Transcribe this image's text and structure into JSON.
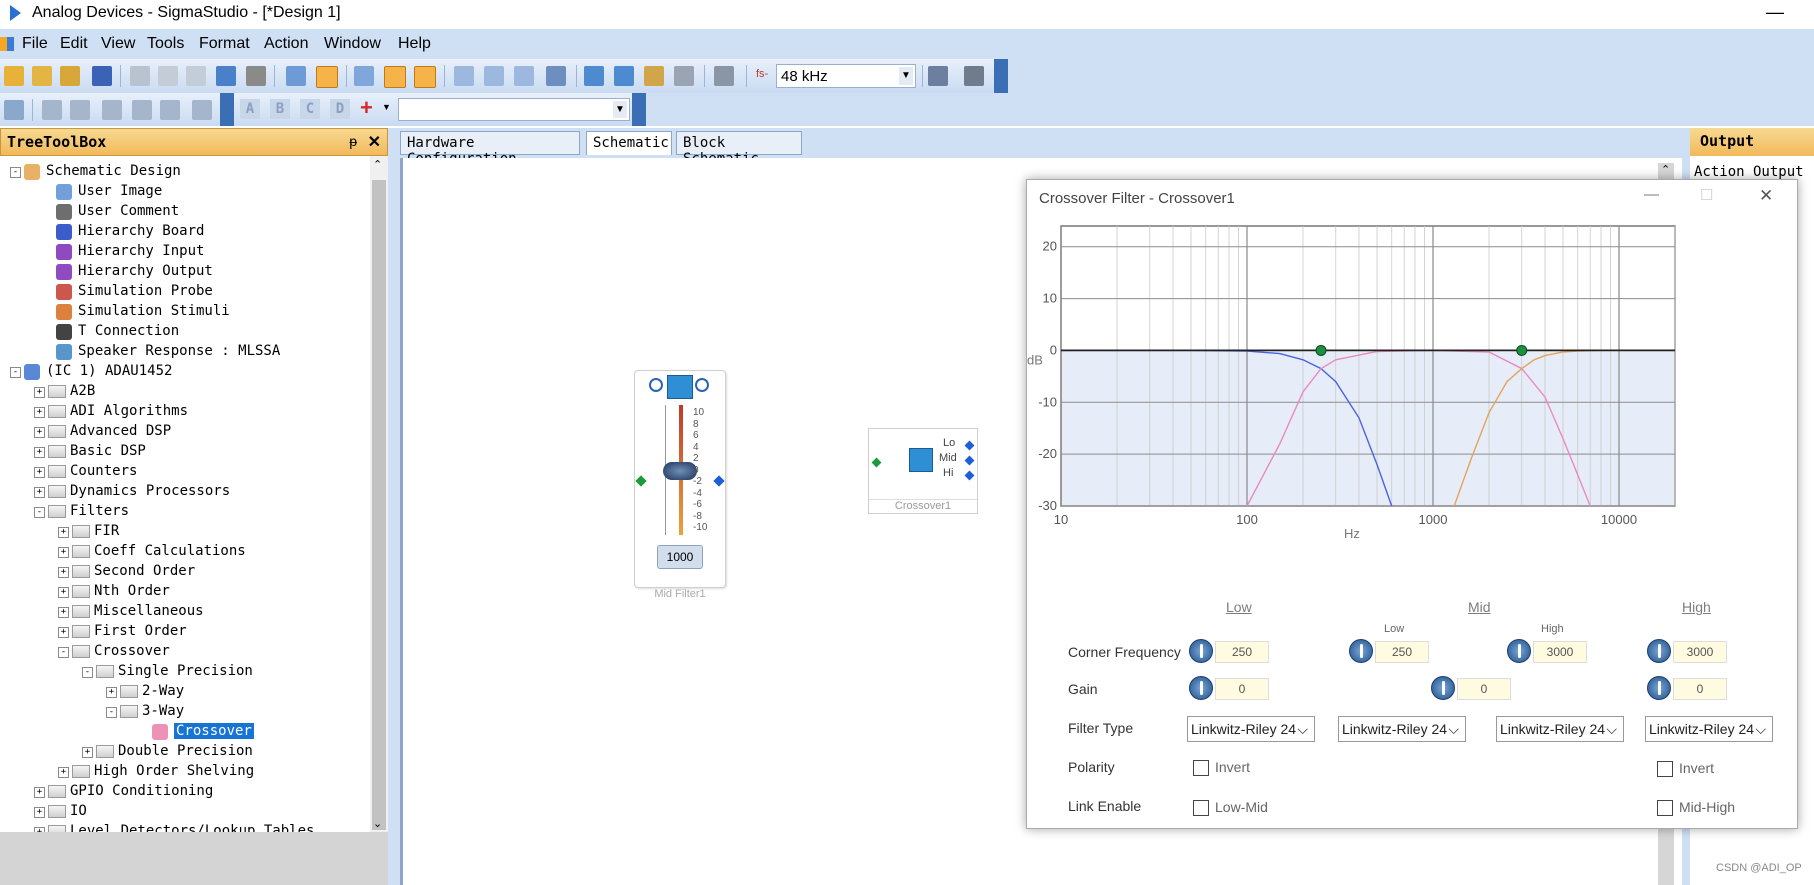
{
  "window": {
    "title": "Analog Devices - SigmaStudio - [*Design 1]",
    "minimize": "—"
  },
  "menu": [
    "File",
    "Edit",
    "View",
    "Tools",
    "Format",
    "Action",
    "Window",
    "Help"
  ],
  "toolbar": {
    "sample_rate": "48 kHz",
    "fs_label": "fs-",
    "style_buttons": [
      "A",
      "B",
      "C",
      "D"
    ],
    "plus": "+"
  },
  "tree": {
    "header": "TreeToolBox",
    "pin": "ᵽ",
    "close": "✕",
    "nodes": [
      {
        "label": "Schematic Design",
        "level": 0,
        "exp": "-",
        "kind": "design"
      },
      {
        "label": "User Image",
        "level": 1,
        "kind": "image"
      },
      {
        "label": "User Comment",
        "level": 1,
        "kind": "comment"
      },
      {
        "label": "Hierarchy Board",
        "level": 1,
        "kind": "board"
      },
      {
        "label": "Hierarchy Input",
        "level": 1,
        "kind": "input"
      },
      {
        "label": "Hierarchy Output",
        "level": 1,
        "kind": "output"
      },
      {
        "label": "Simulation Probe",
        "level": 1,
        "kind": "probe"
      },
      {
        "label": "Simulation Stimuli",
        "level": 1,
        "kind": "stimuli"
      },
      {
        "label": "T Connection",
        "level": 1,
        "kind": "tconn"
      },
      {
        "label": "Speaker Response : MLSSA",
        "level": 1,
        "kind": "speaker"
      },
      {
        "label": "(IC 1) ADAU1452",
        "level": 0,
        "exp": "-",
        "kind": "ic"
      },
      {
        "label": "A2B",
        "level": 1,
        "exp": "+",
        "kind": "folder"
      },
      {
        "label": "ADI Algorithms",
        "level": 1,
        "exp": "+",
        "kind": "folder"
      },
      {
        "label": "Advanced DSP",
        "level": 1,
        "exp": "+",
        "kind": "folder"
      },
      {
        "label": "Basic DSP",
        "level": 1,
        "exp": "+",
        "kind": "folder"
      },
      {
        "label": "Counters",
        "level": 1,
        "exp": "+",
        "kind": "folder"
      },
      {
        "label": "Dynamics Processors",
        "level": 1,
        "exp": "+",
        "kind": "folder"
      },
      {
        "label": "Filters",
        "level": 1,
        "exp": "-",
        "kind": "folder"
      },
      {
        "label": "FIR",
        "level": 2,
        "exp": "+",
        "kind": "folder"
      },
      {
        "label": "Coeff Calculations",
        "level": 2,
        "exp": "+",
        "kind": "folder"
      },
      {
        "label": "Second Order",
        "level": 2,
        "exp": "+",
        "kind": "folder"
      },
      {
        "label": "Nth Order",
        "level": 2,
        "exp": "+",
        "kind": "folder"
      },
      {
        "label": "Miscellaneous",
        "level": 2,
        "exp": "+",
        "kind": "folder"
      },
      {
        "label": "First Order",
        "level": 2,
        "exp": "+",
        "kind": "folder"
      },
      {
        "label": "Crossover",
        "level": 2,
        "exp": "-",
        "kind": "folder"
      },
      {
        "label": "Single Precision",
        "level": 3,
        "exp": "-",
        "kind": "folder"
      },
      {
        "label": "2-Way",
        "level": 4,
        "exp": "+",
        "kind": "folder"
      },
      {
        "label": "3-Way",
        "level": 4,
        "exp": "-",
        "kind": "folder"
      },
      {
        "label": "Crossover",
        "level": 5,
        "kind": "cell",
        "selected": true
      },
      {
        "label": "Double Precision",
        "level": 3,
        "exp": "+",
        "kind": "folder"
      },
      {
        "label": "High Order Shelving",
        "level": 2,
        "exp": "+",
        "kind": "folder"
      },
      {
        "label": "GPIO Conditioning",
        "level": 1,
        "exp": "+",
        "kind": "folder"
      },
      {
        "label": "IO",
        "level": 1,
        "exp": "+",
        "kind": "folder"
      },
      {
        "label": "Level Detectors/Lookup Tables",
        "level": 1,
        "exp": "+",
        "kind": "folder"
      }
    ]
  },
  "tabs": [
    "Hardware Configuration",
    "Schematic",
    "Block Schematic"
  ],
  "active_tab": "Schematic",
  "output_panel": {
    "header": "Output",
    "item": "Action Output"
  },
  "mid_filter": {
    "name": "Mid Filter1",
    "scale": [
      "10",
      "8",
      "6",
      "4",
      "2",
      "0",
      "-2",
      "-4",
      "-6",
      "-8",
      "-10"
    ],
    "value": "1000",
    "level": 0
  },
  "crossover_block": {
    "name": "Crossover1",
    "outputs": [
      "Lo",
      "Mid",
      "Hi"
    ]
  },
  "dialog": {
    "title": "Crossover Filter - Crossover1",
    "controls": {
      "minimize": "—",
      "maximize": "☐",
      "close": "✕"
    },
    "bands": [
      "Low",
      "Mid",
      "High"
    ],
    "sub_labels": {
      "low": "Low",
      "high": "High"
    },
    "rows": {
      "corner_frequency": "Corner Frequency",
      "gain": "Gain",
      "filter_type": "Filter Type",
      "polarity": "Polarity",
      "link_enable": "Link Enable"
    },
    "corner_values": [
      "250",
      "250",
      "3000",
      "3000"
    ],
    "gain_values": [
      "0",
      "0",
      "0"
    ],
    "filter_types": [
      "Linkwitz-Riley 24",
      "Linkwitz-Riley 24",
      "Linkwitz-Riley 24",
      "Linkwitz-Riley 24"
    ],
    "invert_label": "Invert",
    "low_mid_label": "Low-Mid",
    "mid_high_label": "Mid-High",
    "chevron": "⌵"
  },
  "chart_data": {
    "type": "line",
    "xlabel": "Hz",
    "ylabel": "dB",
    "xscale": "log",
    "xlim": [
      10,
      20000
    ],
    "ylim": [
      -30,
      24
    ],
    "xticks": [
      "10",
      "100",
      "1000",
      "10000"
    ],
    "yticks": [
      "20",
      "10",
      "0",
      "-10",
      "-20",
      "-30"
    ],
    "grid": true,
    "series": [
      {
        "color": "#4a63e0",
        "x": [
          10,
          50,
          100,
          150,
          200,
          250,
          300,
          400,
          500,
          600
        ],
        "y": [
          0,
          0,
          -0.1,
          -0.6,
          -1.8,
          -3.5,
          -6,
          -13,
          -22,
          -31
        ]
      },
      {
        "color": "#e98ac0",
        "x": [
          100,
          150,
          200,
          250,
          300,
          500,
          1000,
          2000,
          3000,
          4000,
          5000,
          6000,
          7000
        ],
        "y": [
          -31,
          -18,
          -8,
          -3.5,
          -1.8,
          -0.2,
          0,
          -0.3,
          -3.5,
          -9,
          -17,
          -24,
          -31
        ]
      },
      {
        "color": "#e6a35a",
        "x": [
          1300,
          1600,
          2000,
          2500,
          3000,
          3500,
          4000,
          5000,
          6000,
          8000,
          10000,
          20000
        ],
        "y": [
          -31,
          -21,
          -12,
          -6,
          -3.5,
          -1.8,
          -1,
          -0.3,
          -0.1,
          0,
          0,
          0
        ]
      },
      {
        "color": "#222222",
        "x": [
          10,
          20000
        ],
        "y": [
          0,
          0
        ]
      }
    ],
    "markers": [
      {
        "x": 250,
        "y": 0
      },
      {
        "x": 3000,
        "y": 0
      }
    ],
    "marker_color": "#1d8f3e"
  },
  "watermark": "CSDN @ADI_OP"
}
